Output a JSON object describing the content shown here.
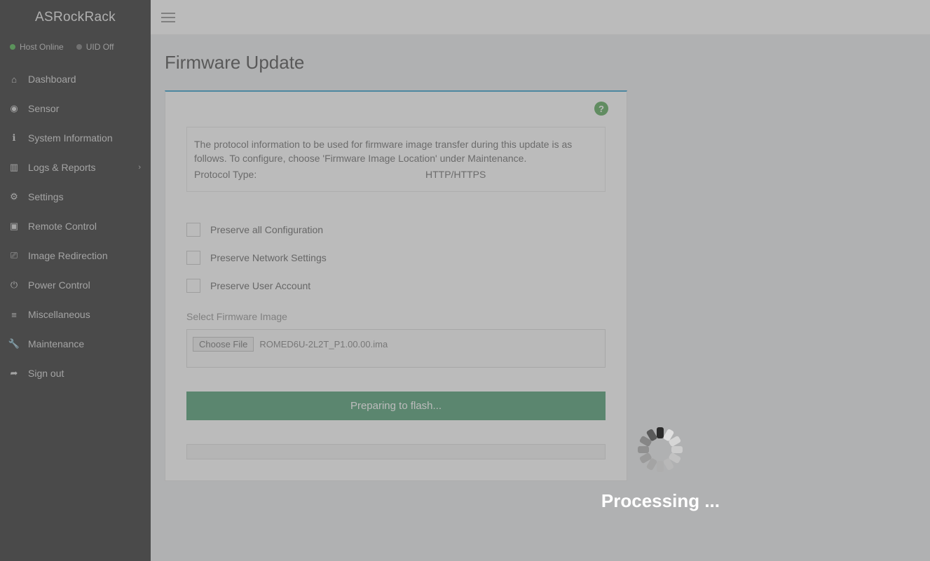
{
  "brand": "ASRockRack",
  "status": {
    "host": "Host Online",
    "uid": "UID Off"
  },
  "nav": {
    "dashboard": "Dashboard",
    "sensor": "Sensor",
    "sysinfo": "System Information",
    "logs": "Logs & Reports",
    "settings": "Settings",
    "remote": "Remote Control",
    "imageredir": "Image Redirection",
    "power": "Power Control",
    "misc": "Miscellaneous",
    "maint": "Maintenance",
    "signout": "Sign out"
  },
  "page": {
    "title": "Firmware Update"
  },
  "info": {
    "desc": "The protocol information to be used for firmware image transfer during this update is as follows. To configure, choose 'Firmware Image Location' under Maintenance.",
    "protocol_label": "Protocol Type:",
    "protocol_value": "HTTP/HTTPS"
  },
  "checks": {
    "all": "Preserve all Configuration",
    "net": "Preserve Network Settings",
    "user": "Preserve User Account"
  },
  "file": {
    "label": "Select Firmware Image",
    "choose": "Choose File",
    "name": "ROMED6U-2L2T_P1.00.00.ima"
  },
  "action": {
    "label": "Preparing to flash..."
  },
  "overlay": {
    "text": "Processing ..."
  }
}
